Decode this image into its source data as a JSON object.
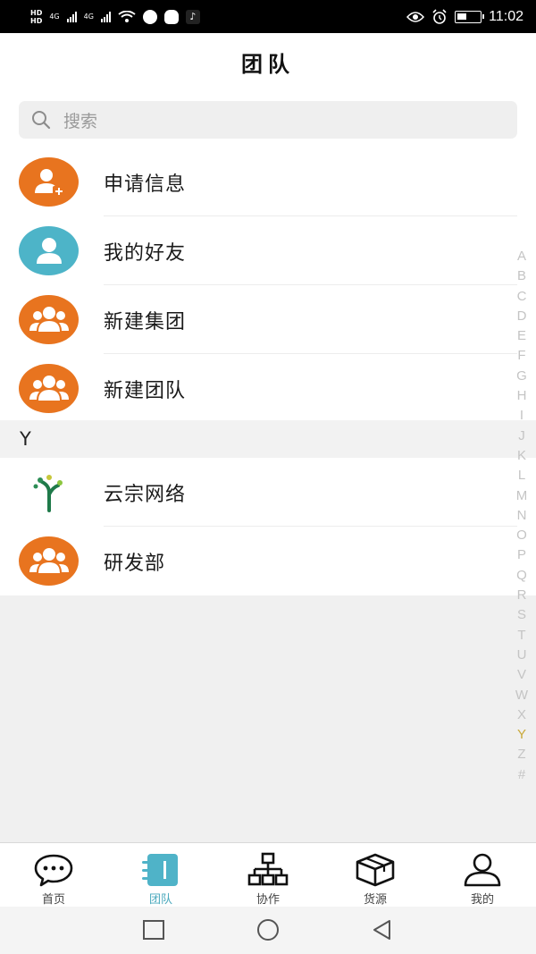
{
  "status_bar": {
    "hd1": "HD",
    "hd2": "HD",
    "net1": "4G",
    "net2": "4G",
    "time": "11:02"
  },
  "header": {
    "title": "团队"
  },
  "search": {
    "placeholder": "搜索"
  },
  "list": [
    {
      "label": "申请信息",
      "icon": "add-user-icon",
      "color": "#e8741f"
    },
    {
      "label": "我的好友",
      "icon": "user-icon",
      "color": "#4db4c8"
    },
    {
      "label": "新建集团",
      "icon": "group-icon",
      "color": "#e8741f"
    },
    {
      "label": "新建团队",
      "icon": "group-icon",
      "color": "#e8741f"
    }
  ],
  "section": {
    "letter": "Y"
  },
  "section_items": [
    {
      "label": "云宗网络",
      "icon": "tree-logo-icon"
    },
    {
      "label": "研发部",
      "icon": "group-icon",
      "color": "#e8741f"
    }
  ],
  "index_letters": [
    "A",
    "B",
    "C",
    "D",
    "E",
    "F",
    "G",
    "H",
    "I",
    "J",
    "K",
    "L",
    "M",
    "N",
    "O",
    "P",
    "Q",
    "R",
    "S",
    "T",
    "U",
    "V",
    "W",
    "X",
    "Y",
    "Z",
    "#"
  ],
  "index_active": "Y",
  "tabs": [
    {
      "label": "首页",
      "icon": "chat-icon"
    },
    {
      "label": "团队",
      "icon": "team-icon",
      "active": true
    },
    {
      "label": "协作",
      "icon": "org-chart-icon"
    },
    {
      "label": "货源",
      "icon": "box-icon"
    },
    {
      "label": "我的",
      "icon": "person-icon"
    }
  ],
  "colors": {
    "accent": "#4aa9bd",
    "orange": "#e8741f",
    "teal": "#4db4c8",
    "index_active": "#c9a93a"
  }
}
